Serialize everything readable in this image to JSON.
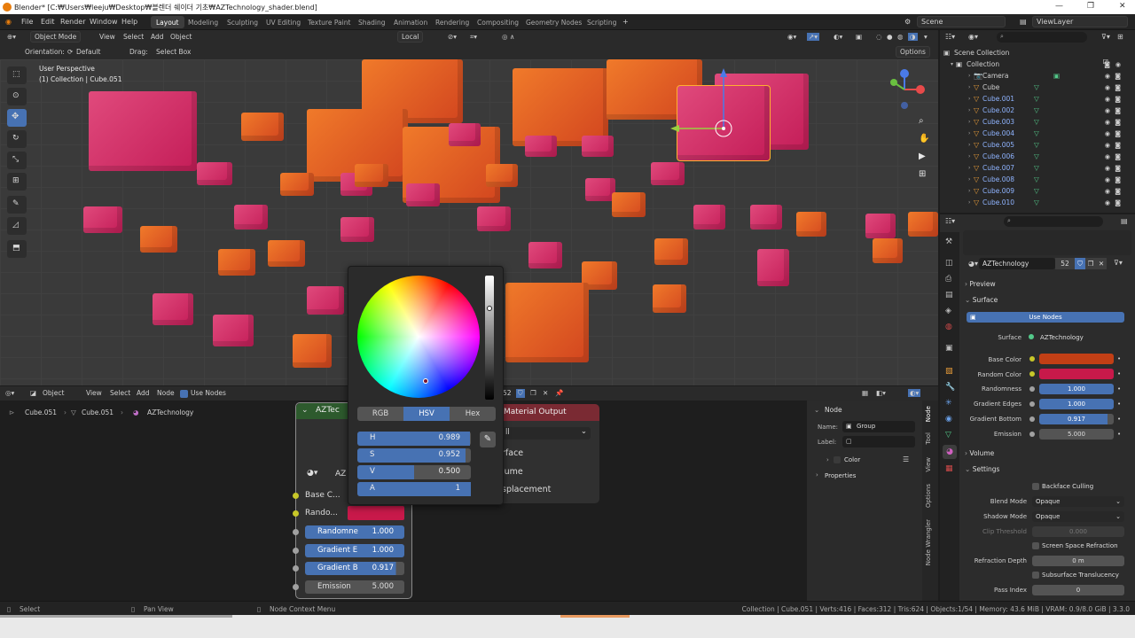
{
  "window": {
    "title": "Blender* [C:₩Users₩leeju₩Desktop₩블렌더 쉐이더 기초₩AZTechnology_shader.blend]"
  },
  "menu": [
    "File",
    "Edit",
    "Render",
    "Window",
    "Help"
  ],
  "workspaces": [
    "Layout",
    "Modeling",
    "Sculpting",
    "UV Editing",
    "Texture Paint",
    "Shading",
    "Animation",
    "Rendering",
    "Compositing",
    "Geometry Nodes",
    "Scripting"
  ],
  "scene": {
    "scene": "Scene",
    "view_layer": "ViewLayer"
  },
  "viewport": {
    "mode": "Object Mode",
    "menus": [
      "View",
      "Select",
      "Add",
      "Object"
    ],
    "orientation_label": "Orientation:",
    "orientation": "Default",
    "drag_label": "Drag:",
    "drag": "Select Box",
    "transform": "Local",
    "options": "Options",
    "info_line1": "User Perspective",
    "info_line2": "(1) Collection | Cube.051"
  },
  "outliner": {
    "root": "Scene Collection",
    "collection": "Collection",
    "items": [
      "Camera",
      "Cube",
      "Cube.001",
      "Cube.002",
      "Cube.003",
      "Cube.004",
      "Cube.005",
      "Cube.006",
      "Cube.007",
      "Cube.008",
      "Cube.009",
      "Cube.010"
    ]
  },
  "properties": {
    "material": "AZTechnology",
    "users": "52",
    "preview": "Preview",
    "surface_section": "Surface",
    "use_nodes": "Use Nodes",
    "surface_label": "Surface",
    "surface_value": "AZTechnology",
    "params": [
      {
        "label": "Base Color",
        "value": "",
        "color": "#c23f15"
      },
      {
        "label": "Random Color",
        "value": "",
        "color": "#c8194a"
      },
      {
        "label": "Randomness",
        "value": "1.000"
      },
      {
        "label": "Gradient Edges",
        "value": "1.000"
      },
      {
        "label": "Gradient Bottom",
        "value": "0.917"
      },
      {
        "label": "Emission",
        "value": "5.000"
      }
    ],
    "volume": "Volume",
    "settings": "Settings",
    "backface": "Backface Culling",
    "blend_mode_label": "Blend Mode",
    "blend_mode": "Opaque",
    "shadow_mode_label": "Shadow Mode",
    "shadow_mode": "Opaque",
    "clip_label": "Clip Threshold",
    "clip": "0.000",
    "ssr": "Screen Space Refraction",
    "refraction_label": "Refraction Depth",
    "refraction": "0 m",
    "sss": "Subsurface Translucency",
    "pass_label": "Pass Index",
    "pass": "0"
  },
  "node_editor": {
    "type": "Object",
    "menus": [
      "View",
      "Select",
      "Add",
      "Node"
    ],
    "use_nodes": "Use Nodes",
    "breadcrumb": [
      "Cube.051",
      "Cube.051",
      "AZTechnology"
    ],
    "group_node": {
      "title": "AZTec",
      "sub": "AZ",
      "inputs": [
        "Base C...",
        "Rando..."
      ],
      "fields": [
        {
          "label": "Randomne",
          "value": "1.000"
        },
        {
          "label": "Gradient E",
          "value": "1.000"
        },
        {
          "label": "Gradient B",
          "value": "0.917"
        },
        {
          "label": "Emission",
          "value": "5.000"
        }
      ]
    },
    "output_node": {
      "title": "Material Output",
      "target": "ll",
      "sockets": [
        "rface",
        "lume",
        "splacement"
      ]
    },
    "material_count": "52"
  },
  "node_sidebar": {
    "panel": "Node",
    "name_label": "Name:",
    "name_value": "Group",
    "label_label": "Label:",
    "color": "Color",
    "properties": "Properties",
    "tabs": [
      "Node",
      "Tool",
      "View",
      "Options",
      "Node Wrangler"
    ]
  },
  "color_picker": {
    "tabs": [
      "RGB",
      "HSV",
      "Hex"
    ],
    "active_tab": "HSV",
    "fields": [
      {
        "label": "H",
        "value": "0.989",
        "fill": 0.989
      },
      {
        "label": "S",
        "value": "0.952",
        "fill": 0.952
      },
      {
        "label": "V",
        "value": "0.500",
        "fill": 0.5
      },
      {
        "label": "A",
        "value": "1",
        "fill": 1.0
      }
    ]
  },
  "status": {
    "left": "Select",
    "middle": "Pan View",
    "right_hint": "Node Context Menu",
    "stats": "Collection | Cube.051 | Verts:416 | Faces:312 | Tris:624 | Objects:1/54 | Memory: 43.6 MiB | VRAM: 0.9/8.0 GiB | 3.3.0"
  }
}
